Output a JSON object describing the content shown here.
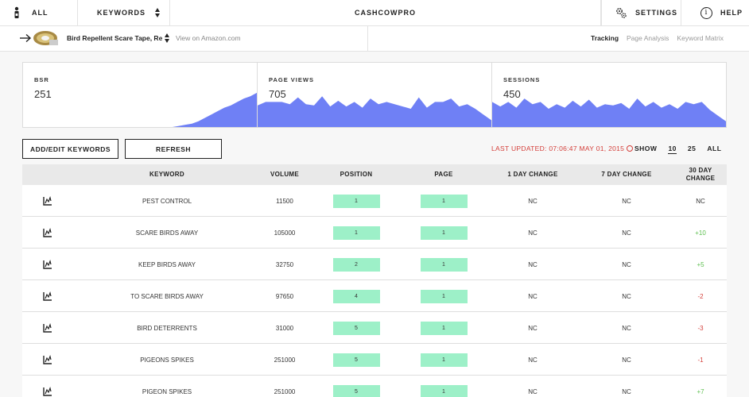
{
  "nav": {
    "all_label": "ALL",
    "keywords_label": "KEYWORDS",
    "brand": "CASHCOWPRO",
    "settings_label": "SETTINGS",
    "help_label": "HELP",
    "help_glyph": "i"
  },
  "product": {
    "title": "Bird Repellent Scare Tape, Re",
    "amazon_link": "View on Amazon.com",
    "tabs": [
      "Tracking",
      "Page Analysis",
      "Keyword Matrix"
    ],
    "active_tab": "Tracking"
  },
  "stats": [
    {
      "label": "BSR",
      "value": "251",
      "spark": [
        0,
        0,
        0,
        0,
        0,
        0,
        0,
        0,
        0,
        0,
        0,
        0,
        0,
        0,
        0,
        0,
        0,
        0,
        0,
        0,
        0,
        0,
        0,
        0,
        1,
        2,
        3,
        5,
        8,
        11,
        14,
        17,
        19,
        22,
        25,
        27,
        30
      ]
    },
    {
      "label": "PAGE VIEWS",
      "value": "705",
      "spark": [
        19,
        22,
        22,
        22,
        20,
        26,
        20,
        19,
        27,
        18,
        23,
        18,
        22,
        17,
        25,
        20,
        22,
        20,
        18,
        16,
        26,
        17,
        22,
        22,
        25,
        18,
        20,
        16,
        11,
        6
      ]
    },
    {
      "label": "SESSIONS",
      "value": "450",
      "spark": [
        22,
        18,
        22,
        17,
        25,
        20,
        22,
        16,
        20,
        17,
        23,
        18,
        24,
        17,
        20,
        19,
        21,
        16,
        25,
        18,
        22,
        17,
        20,
        16,
        22,
        20,
        22,
        15,
        10,
        5
      ]
    }
  ],
  "chart_color": "#6f80f5",
  "controls": {
    "add_edit_label": "ADD/EDIT KEYWORDS",
    "refresh_label": "REFRESH",
    "last_updated": "LAST UPDATED: 07:06:47 MAY 01, 2015",
    "show_label": "SHOW",
    "show_options": [
      "10",
      "25",
      "ALL"
    ],
    "show_selected": "10"
  },
  "table": {
    "headers": [
      "KEYWORD",
      "VOLUME",
      "POSITION",
      "PAGE",
      "1 DAY CHANGE",
      "7 DAY CHANGE",
      "30 DAY CHANGE"
    ],
    "rows": [
      {
        "keyword": "PEST CONTROL",
        "volume": "11500",
        "position": "1",
        "page": "1",
        "d1": "NC",
        "d7": "NC",
        "d30": "NC"
      },
      {
        "keyword": "SCARE BIRDS AWAY",
        "volume": "105000",
        "position": "1",
        "page": "1",
        "d1": "NC",
        "d7": "NC",
        "d30": "+10"
      },
      {
        "keyword": "KEEP BIRDS AWAY",
        "volume": "32750",
        "position": "2",
        "page": "1",
        "d1": "NC",
        "d7": "NC",
        "d30": "+5"
      },
      {
        "keyword": "TO SCARE BIRDS AWAY",
        "volume": "97650",
        "position": "4",
        "page": "1",
        "d1": "NC",
        "d7": "NC",
        "d30": "-2"
      },
      {
        "keyword": "BIRD DETERRENTS",
        "volume": "31000",
        "position": "5",
        "page": "1",
        "d1": "NC",
        "d7": "NC",
        "d30": "-3"
      },
      {
        "keyword": "PIGEONS SPIKES",
        "volume": "251000",
        "position": "5",
        "page": "1",
        "d1": "NC",
        "d7": "NC",
        "d30": "-1"
      },
      {
        "keyword": "PIGEON SPIKES",
        "volume": "251000",
        "position": "5",
        "page": "1",
        "d1": "NC",
        "d7": "NC",
        "d30": "+7"
      }
    ]
  }
}
